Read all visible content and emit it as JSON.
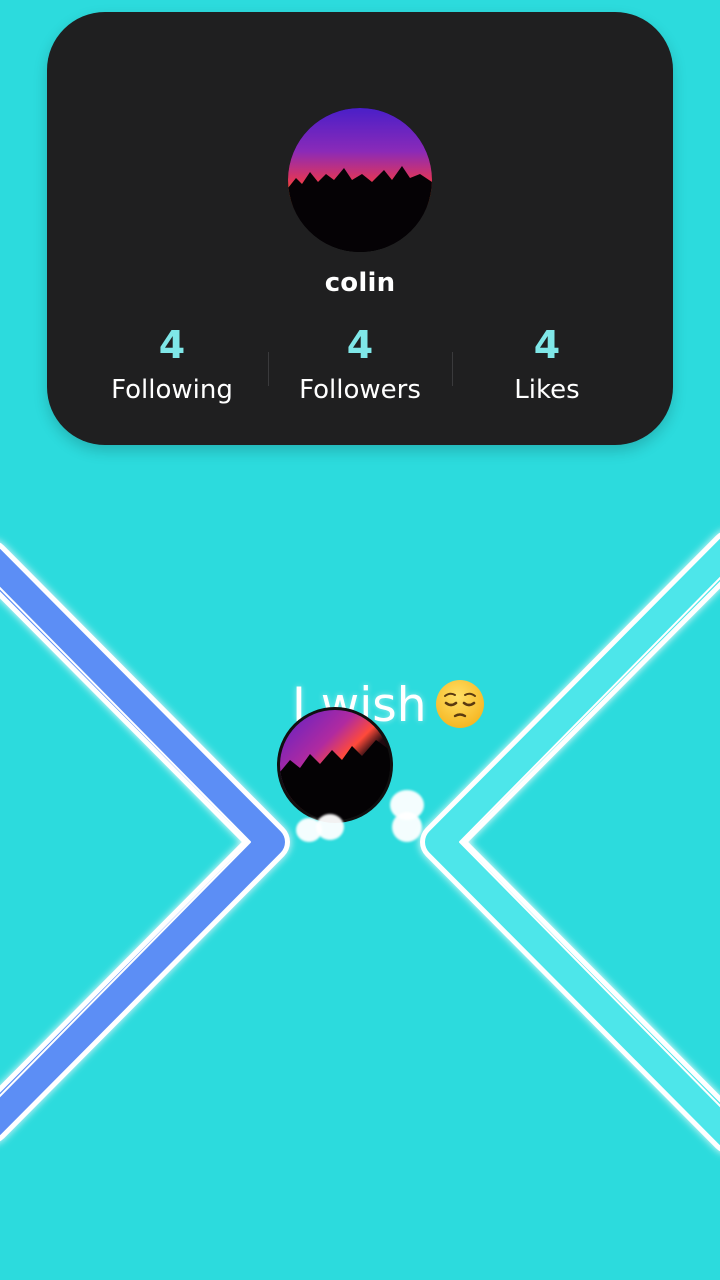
{
  "profile": {
    "username": "colin",
    "avatar": "sunset-silhouette-photo",
    "stats": [
      {
        "value": "4",
        "label": "Following"
      },
      {
        "value": "4",
        "label": "Followers"
      },
      {
        "value": "4",
        "label": "Likes"
      }
    ]
  },
  "game": {
    "caption": "I wish",
    "caption_emoji": "pensive-face-emoji",
    "left_wall_color": "#5b8ef5",
    "right_wall_color": "#4de6ea",
    "background_color": "#2cdbdd"
  }
}
